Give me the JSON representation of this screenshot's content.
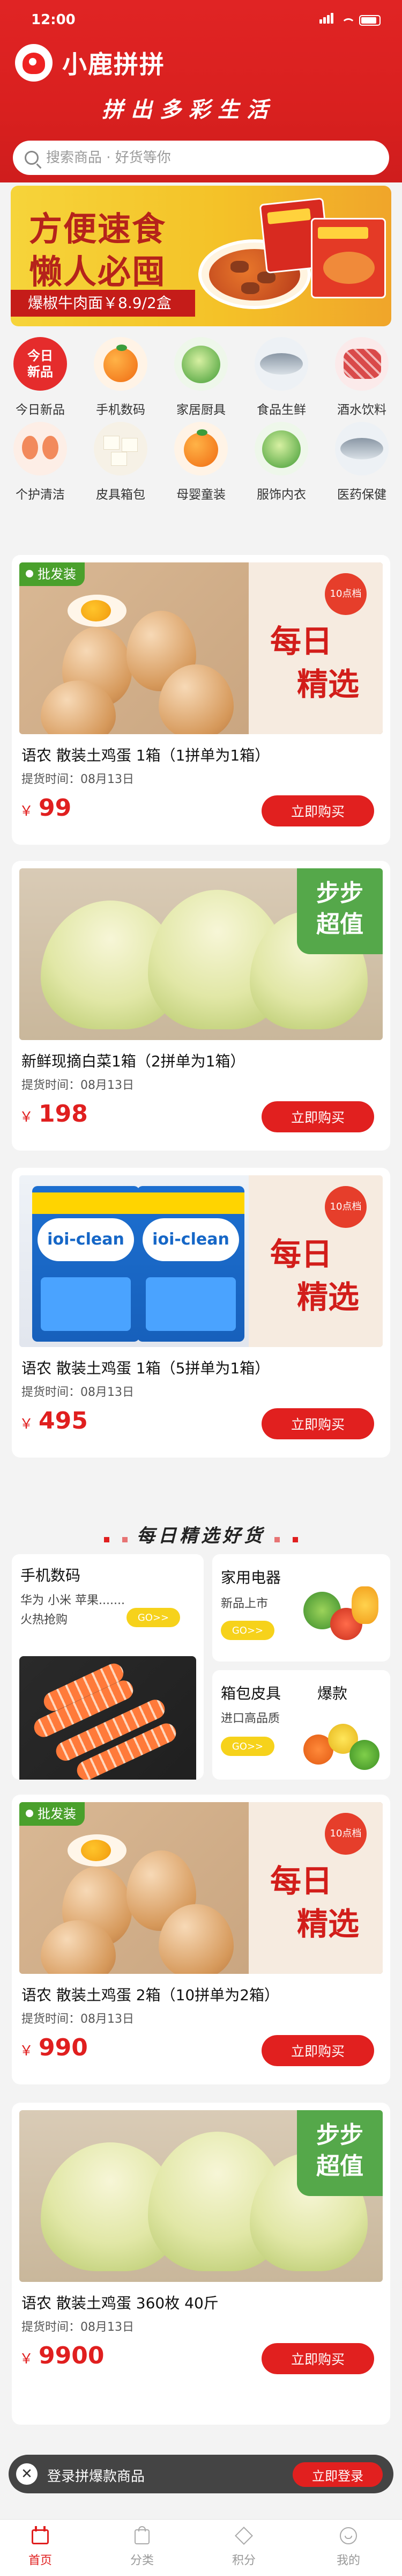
{
  "status": {
    "time": "12:00"
  },
  "header": {
    "title": "小鹿拼拼",
    "slogan": "拼出多彩生活"
  },
  "search": {
    "placeholder": "搜索商品 · 好货等你"
  },
  "banner": {
    "line1": "方便速食",
    "line2": "懒人必囤",
    "tag": "爆椒牛肉面￥8.9/2盒"
  },
  "categories": [
    {
      "label": "今日新品",
      "icon": "today-new"
    },
    {
      "label": "手机数码",
      "icon": "orange"
    },
    {
      "label": "家居厨具",
      "icon": "cabbage"
    },
    {
      "label": "食品生鲜",
      "icon": "fish"
    },
    {
      "label": "酒水饮料",
      "icon": "meat"
    },
    {
      "label": "个护清洁",
      "icon": "shrimp"
    },
    {
      "label": "皮具箱包",
      "icon": "tofu"
    },
    {
      "label": "母婴童装",
      "icon": "orange"
    },
    {
      "label": "服饰内衣",
      "icon": "cabbage"
    },
    {
      "label": "医药保健",
      "icon": "fish"
    }
  ],
  "today_new_text": "今日\n新品",
  "products": [
    {
      "title": "语农 散装土鸡蛋 1箱（1拼单为1箱）",
      "time": "提货时间：08月13日",
      "price": "99",
      "button": "立即购买",
      "badge": "批发装",
      "promo": "每日精选",
      "promo_badge": "10点档"
    },
    {
      "title": "新鲜现摘白菜1箱（2拼单为1箱）",
      "time": "提货时间：08月13日",
      "price": "198",
      "button": "立即购买",
      "promo": "步步超值"
    },
    {
      "title": "语农 散装土鸡蛋 1箱（5拼单为1箱）",
      "time": "提货时间：08月13日",
      "price": "495",
      "button": "立即购买",
      "promo": "每日精选",
      "promo_badge": "10点档",
      "package_text": "ioi-clean"
    },
    {
      "title": "语农 散装土鸡蛋 2箱（10拼单为2箱）",
      "time": "提货时间：08月13日",
      "price": "990",
      "button": "立即购买",
      "badge": "批发装",
      "promo": "每日精选",
      "promo_badge": "10点档"
    },
    {
      "title": "语农 散装土鸡蛋  360枚 40斤",
      "time": "提货时间：08月13日",
      "price": "9900",
      "button": "立即购买",
      "promo": "步步超值"
    }
  ],
  "currency": "￥",
  "section": {
    "title": "每日精选好货"
  },
  "mini": {
    "digital": {
      "title": "手机数码",
      "sub1": "华为 小米 苹果.......",
      "sub2": "火热抢购",
      "go": "GO>>"
    },
    "appliance": {
      "title": "家用电器",
      "sub": "新品上市",
      "go": "GO>>"
    },
    "bags": {
      "title": "箱包皮具",
      "extra": "爆款",
      "sub": "进口高品质",
      "go": "GO>>"
    }
  },
  "login": {
    "close": "✕",
    "text": "登录拼爆款商品",
    "button": "立即登录"
  },
  "tabs": [
    {
      "label": "首页",
      "icon": "home-icon"
    },
    {
      "label": "分类",
      "icon": "category-icon"
    },
    {
      "label": "积分",
      "icon": "points-icon"
    },
    {
      "label": "我的",
      "icon": "profile-icon"
    }
  ]
}
